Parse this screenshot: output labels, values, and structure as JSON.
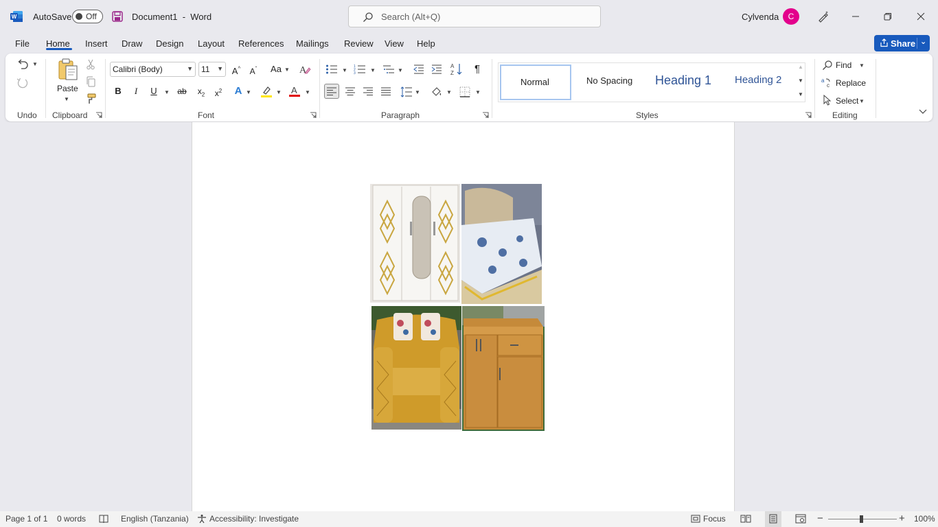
{
  "titlebar": {
    "app_icon": "word-logo-icon",
    "autosave_label": "AutoSave",
    "autosave_state": "Off",
    "doc_title": "Document1  -  Word",
    "search_placeholder": "Search (Alt+Q)",
    "user_name": "Cylvenda",
    "avatar_initial": "C",
    "avatar_color": "#e3008c"
  },
  "menu": {
    "tabs": [
      "File",
      "Home",
      "Insert",
      "Draw",
      "Design",
      "Layout",
      "References",
      "Mailings",
      "Review",
      "View",
      "Help"
    ],
    "active_tab": "Home",
    "share_label": "Share",
    "accent": "#185abd"
  },
  "ribbon": {
    "groups": {
      "undo": "Undo",
      "clipboard": "Clipboard",
      "font": "Font",
      "paragraph": "Paragraph",
      "styles": "Styles",
      "editing": "Editing"
    },
    "paste_label": "Paste",
    "font_name": "Calibri (Body)",
    "font_size": "11",
    "change_case": "Aa",
    "styles": [
      "Normal",
      "No Spacing",
      "Heading 1",
      "Heading 2"
    ],
    "selected_style": "Normal",
    "find_label": "Find",
    "replace_label": "Replace",
    "select_label": "Select"
  },
  "document": {
    "images": [
      "wardrobe-photo",
      "bed-photo",
      "sofa-photo",
      "cabinet-photo"
    ]
  },
  "status": {
    "page": "Page 1 of 1",
    "words": "0 words",
    "language": "English (Tanzania)",
    "accessibility": "Accessibility: Investigate",
    "focus": "Focus",
    "zoom": "100%"
  }
}
